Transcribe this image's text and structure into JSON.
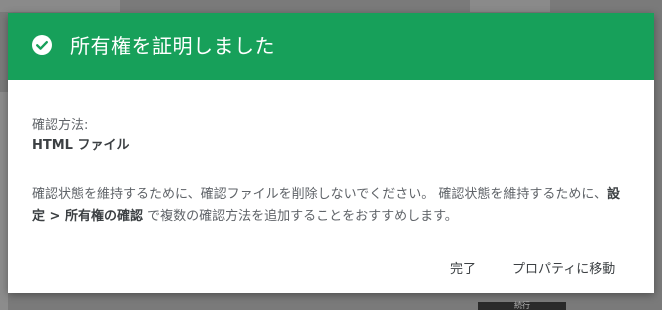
{
  "dialog": {
    "title": "所有権を証明しました",
    "method_label": "確認方法:",
    "method_value": "HTML ファイル",
    "notice_part1": "確認状態を維持するために、確認ファイルを削除しないでください。 確認状態を維持するために、",
    "notice_bold": "設定 > 所有権の確認",
    "notice_part2": " で複数の確認方法を追加することをおすすめします。",
    "done_label": "完了",
    "go_label": "プロパティに移動"
  },
  "colors": {
    "header": "#17a05a",
    "overlay": "#7a7a7a"
  },
  "icons": {
    "header_icon": "check-circle-icon"
  },
  "background": {
    "bottom_button_label": "続行"
  }
}
